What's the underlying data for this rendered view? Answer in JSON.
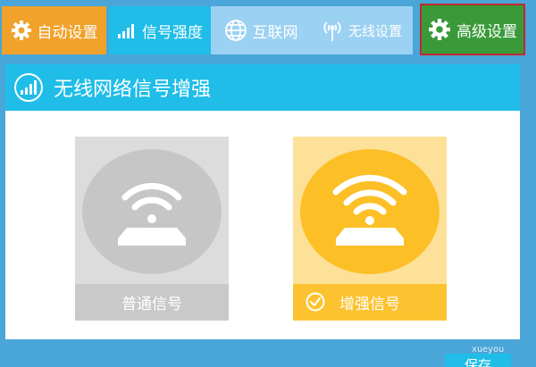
{
  "nav": {
    "tabs": [
      {
        "label": "自动设置",
        "icon": "gear-icon",
        "color": "#f0a22b"
      },
      {
        "label": "信号强度",
        "icon": "signal-bars-icon",
        "color": "#1fbde8",
        "active": true
      },
      {
        "label": "互联网",
        "icon": "globe-icon",
        "color": "#9bd1f2"
      },
      {
        "label": "无线设置",
        "icon": "antenna-icon",
        "color": "#9bd1f2"
      },
      {
        "label": "高级设置",
        "icon": "gear-icon",
        "color": "#3a9a3a",
        "highlighted": true
      }
    ]
  },
  "panel": {
    "title": "无线网络信号增强",
    "title_icon": "signal-bars-icon",
    "options": [
      {
        "label": "普通信号",
        "icon": "wifi-router-icon",
        "selected": false,
        "color": "#c6c6c6"
      },
      {
        "label": "增强信号",
        "icon": "wifi-router-icon",
        "selected": true,
        "color": "#fdbf26"
      }
    ]
  },
  "save_label": "保存",
  "watermark": "xueyou"
}
